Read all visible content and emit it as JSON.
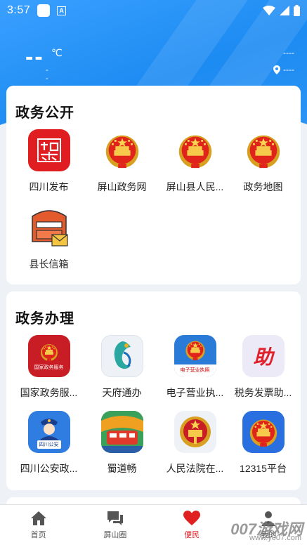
{
  "status": {
    "time": "3:57"
  },
  "weather": {
    "temp": "--",
    "unit": "℃",
    "sub": "----",
    "loc_top": "----",
    "loc_bottom": "----"
  },
  "section1": {
    "title": "政务公开",
    "items": [
      {
        "label": "四川发布",
        "icon": "sichuan-publish-icon"
      },
      {
        "label": "屏山政务网",
        "icon": "national-emblem-icon"
      },
      {
        "label": "屏山县人民...",
        "icon": "national-emblem-icon"
      },
      {
        "label": "政务地图",
        "icon": "national-emblem-icon"
      },
      {
        "label": "县长信箱",
        "icon": "mailbox-icon"
      }
    ]
  },
  "section2": {
    "title": "政务办理",
    "items": [
      {
        "label": "国家政务服...",
        "icon": "national-gov-service-icon",
        "badge": "国家政务服务"
      },
      {
        "label": "天府通办",
        "icon": "tianfu-tongban-icon"
      },
      {
        "label": "电子营业执...",
        "icon": "e-business-license-icon",
        "badge": "电子营业执照"
      },
      {
        "label": "税务发票助...",
        "icon": "tax-invoice-icon",
        "badge": "助"
      },
      {
        "label": "四川公安政...",
        "icon": "sichuan-police-icon",
        "badge": "四川公安"
      },
      {
        "label": "蜀道畅",
        "icon": "shudao-chang-icon"
      },
      {
        "label": "人民法院在...",
        "icon": "court-emblem-icon"
      },
      {
        "label": "12315平台",
        "icon": "national-emblem-icon"
      }
    ]
  },
  "tabbar": {
    "tabs": [
      {
        "label": "首页",
        "icon": "home-icon"
      },
      {
        "label": "屏山圈",
        "icon": "chat-icon"
      },
      {
        "label": "便民",
        "icon": "heart-icon",
        "active": true
      },
      {
        "label": "我的",
        "icon": "person-icon"
      }
    ]
  },
  "watermark": {
    "main": "007游戏网",
    "sub": "www.y007.com"
  },
  "colors": {
    "primary": "#1c8bf2",
    "active": "#e02020"
  }
}
